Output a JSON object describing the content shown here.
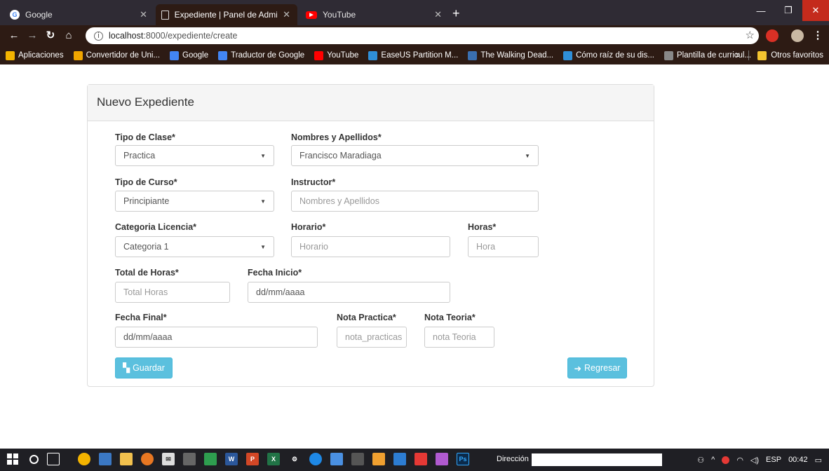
{
  "browser": {
    "tabs": [
      {
        "title": "Google",
        "active": false
      },
      {
        "title": "Expediente | Panel de Administr",
        "active": true
      },
      {
        "title": "YouTube",
        "active": false
      }
    ],
    "url_host": "localhost",
    "url_rest": ":8000/expediente/create",
    "bookmarks": [
      {
        "label": "Aplicaciones",
        "icon": "apps-grid-icon",
        "color": "#f4b400"
      },
      {
        "label": "Convertidor de Uni...",
        "icon": "converter-icon",
        "color": "#f0a500"
      },
      {
        "label": "Google",
        "icon": "google-icon",
        "color": "#4285f4"
      },
      {
        "label": "Traductor de Google",
        "icon": "translate-icon",
        "color": "#4285f4"
      },
      {
        "label": "YouTube",
        "icon": "youtube-icon",
        "color": "#ff0000"
      },
      {
        "label": "EaseUS Partition M...",
        "icon": "easeus-icon",
        "color": "#2f8fd8"
      },
      {
        "label": "The Walking Dead...",
        "icon": "walking-dead-icon",
        "color": "#3a6fb0"
      },
      {
        "label": "Cómo raíz de su dis...",
        "icon": "link-icon",
        "color": "#2f8fd8"
      },
      {
        "label": "Plantilla de curricul...",
        "icon": "template-icon",
        "color": "#888888"
      }
    ],
    "more_label": "»",
    "other_bookmarks": "Otros favoritos"
  },
  "form": {
    "heading": "Nuevo Expediente",
    "tipo_clase": {
      "label": "Tipo de Clase*",
      "value": "Practica"
    },
    "nombres": {
      "label": "Nombres y Apellidos*",
      "value": "Francisco Maradiaga"
    },
    "tipo_curso": {
      "label": "Tipo de Curso*",
      "value": "Principiante"
    },
    "instructor": {
      "label": "Instructor*",
      "placeholder": "Nombres y Apellidos"
    },
    "categoria": {
      "label": "Categoria Licencia*",
      "value": "Categoria 1"
    },
    "horario": {
      "label": "Horario*",
      "placeholder": "Horario"
    },
    "horas": {
      "label": "Horas*",
      "placeholder": "Hora"
    },
    "total_horas": {
      "label": "Total de Horas*",
      "placeholder": "Total Horas"
    },
    "fecha_inicio": {
      "label": "Fecha Inicio*",
      "value": "dd/mm/aaaa"
    },
    "fecha_final": {
      "label": "Fecha Final*",
      "value": "dd/mm/aaaa"
    },
    "nota_practica": {
      "label": "Nota Practica*",
      "placeholder": "nota_practicas"
    },
    "nota_teoria": {
      "label": "Nota Teoria*",
      "placeholder": "nota Teoria"
    },
    "save_label": "Guardar",
    "back_label": "Regresar"
  },
  "taskbar": {
    "address_label": "Dirección",
    "lang": "ESP",
    "time": "00:42"
  }
}
